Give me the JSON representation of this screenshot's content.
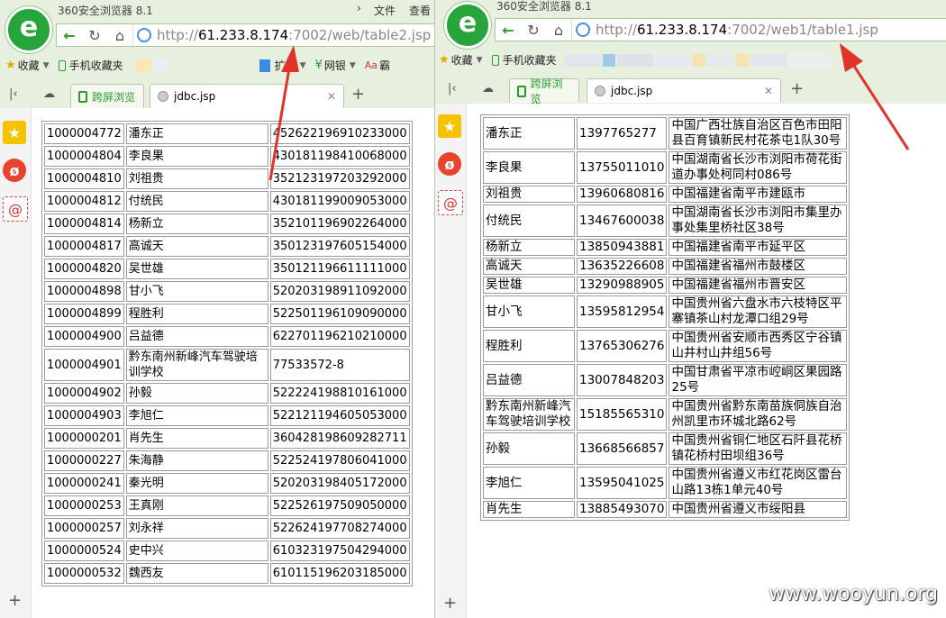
{
  "left_window": {
    "app_title": "360安全浏览器 8.1",
    "menu": [
      "文件",
      "查看"
    ],
    "url": {
      "proto": "http://",
      "host": "61.233.8.174",
      "path": ":7002/web/table2.jsp"
    },
    "bookmarks": {
      "favorites": "收藏",
      "mobile": "手机收藏夹",
      "extensions": "扩展",
      "bank": "网银",
      "more": "霸"
    },
    "tabs": [
      {
        "label": "跨屏浏览"
      },
      {
        "label": "jdbc.jsp"
      }
    ],
    "table": [
      [
        "1000004772",
        "潘东正",
        "452622196910233000"
      ],
      [
        "1000004804",
        "李良果",
        "430181198410068000"
      ],
      [
        "1000004810",
        "刘祖贵",
        "352123197203292000"
      ],
      [
        "1000004812",
        "付统民",
        "430181199009053000"
      ],
      [
        "1000004814",
        "杨新立",
        "352101196902264000"
      ],
      [
        "1000004817",
        "高诚天",
        "350123197605154000"
      ],
      [
        "1000004820",
        "吴世雄",
        "350121196611111000"
      ],
      [
        "1000004898",
        "甘小飞",
        "520203198911092000"
      ],
      [
        "1000004899",
        "程胜利",
        "522501196109090000"
      ],
      [
        "1000004900",
        "吕益德",
        "622701196210210000"
      ],
      [
        "1000004901",
        "黔东南州新峰汽车驾驶培训学校",
        "77533572-8"
      ],
      [
        "1000004902",
        "孙毅",
        "522224198810161000"
      ],
      [
        "1000004903",
        "李旭仁",
        "522121194605053000"
      ],
      [
        "1000000201",
        "肖先生",
        "360428198609282711"
      ],
      [
        "1000000227",
        "朱海静",
        "522524197806041000"
      ],
      [
        "1000000241",
        "秦光明",
        "520203198405172000"
      ],
      [
        "1000000253",
        "王真刚",
        "522526197509050000"
      ],
      [
        "1000000257",
        "刘永祥",
        "522624197708274000"
      ],
      [
        "1000000524",
        "史中兴",
        "610323197504294000"
      ],
      [
        "1000000532",
        "魏西友",
        "610115196203185000"
      ]
    ]
  },
  "right_window": {
    "app_title": "360安全浏览器 8.1",
    "url": {
      "proto": "http://",
      "host": "61.233.8.174",
      "path": ":7002/web1/table1.jsp"
    },
    "bookmarks": {
      "favorites": "收藏",
      "mobile": "手机收藏夹"
    },
    "tabs": [
      {
        "label": "跨屏浏览"
      },
      {
        "label": "jdbc.jsp"
      }
    ],
    "table": [
      [
        "潘东正",
        "1397765277",
        "中国广西壮族自治区百色市田阳县百育镇新民村花茶屯1队30号"
      ],
      [
        "李良果",
        "13755011010",
        "中国湖南省长沙市浏阳市荷花街道办事处柯同村086号"
      ],
      [
        "刘祖贵",
        "13960680816",
        "中国福建省南平市建瓯市"
      ],
      [
        "付统民",
        "13467600038",
        "中国湖南省长沙市浏阳市集里办事处集里桥社区38号"
      ],
      [
        "杨新立",
        "13850943881",
        "中国福建省南平市延平区"
      ],
      [
        "高诚天",
        "13635226608",
        "中国福建省福州市鼓楼区"
      ],
      [
        "吴世雄",
        "13290988905",
        "中国福建省福州市晋安区"
      ],
      [
        "甘小飞",
        "13595812954",
        "中国贵州省六盘水市六枝特区平寨镇茶山村龙潭口组29号"
      ],
      [
        "程胜利",
        "13765306276",
        "中国贵州省安顺市西秀区宁谷镇山井村山井组56号"
      ],
      [
        "吕益德",
        "13007848203",
        "中国甘肃省平凉市崆峒区果园路25号"
      ],
      [
        "黔东南州新峰汽车驾驶培训学校",
        "15185565310",
        "中国贵州省黔东南苗族侗族自治州凯里市环城北路62号"
      ],
      [
        "孙毅",
        "13668566857",
        "中国贵州省铜仁地区石阡县花桥镇花桥村田坝组36号"
      ],
      [
        "李旭仁",
        "13595041025",
        "中国贵州省遵义市红花岗区雷台山路13栋1单元40号"
      ],
      [
        "肖先生",
        "13885493070",
        "中国贵州省遵义市绥阳县"
      ]
    ]
  },
  "watermark": "www.wooyun.org",
  "colors": {
    "chrome": "#e7f0df",
    "logo": "#27a53a",
    "arrow": "#e0332a"
  }
}
